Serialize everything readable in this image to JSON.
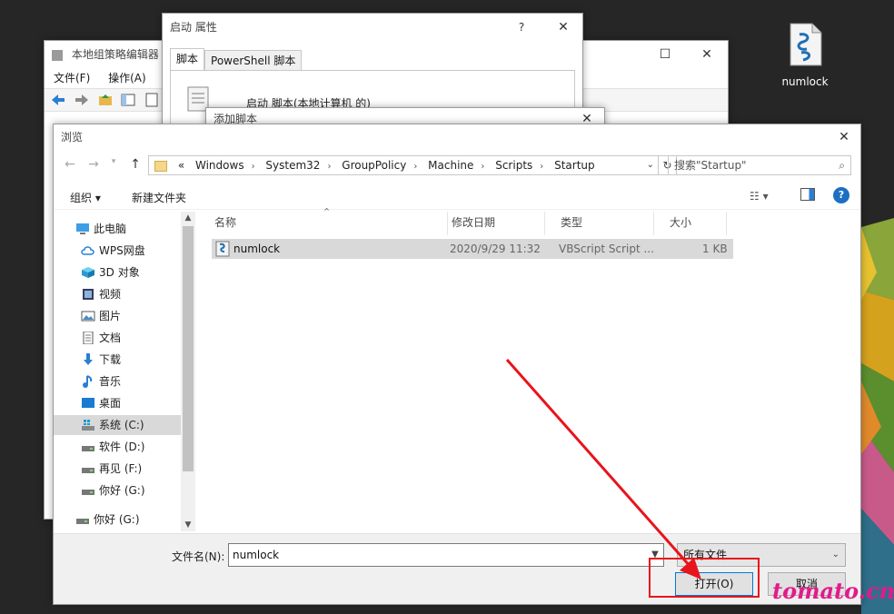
{
  "desktop": {
    "icon_label": "numlock",
    "watermark": "tomato.cn"
  },
  "gpe_window": {
    "title": "本地组策略编辑器",
    "menu": [
      "文件(F)",
      "操作(A)",
      "查"
    ]
  },
  "props_window": {
    "title": "启动 属性",
    "help": "?",
    "tabs": [
      "脚本",
      "PowerShell 脚本"
    ],
    "heading": "启动 脚本(本地计算机 的)"
  },
  "add_script_window": {
    "title": "添加脚本"
  },
  "browse_dialog": {
    "title": "浏览",
    "address_prefix": "«",
    "path": [
      "Windows",
      "System32",
      "GroupPolicy",
      "Machine",
      "Scripts",
      "Startup"
    ],
    "search_placeholder": "搜索\"Startup\"",
    "toolbar": {
      "organize": "组织 ▾",
      "new_folder": "新建文件夹"
    },
    "nav_items": [
      {
        "label": "此电脑",
        "icon": "computer-icon"
      },
      {
        "label": "WPS网盘",
        "icon": "cloud-icon"
      },
      {
        "label": "3D 对象",
        "icon": "cube-icon"
      },
      {
        "label": "视频",
        "icon": "video-icon"
      },
      {
        "label": "图片",
        "icon": "picture-icon"
      },
      {
        "label": "文档",
        "icon": "document-icon"
      },
      {
        "label": "下载",
        "icon": "download-icon"
      },
      {
        "label": "音乐",
        "icon": "music-icon"
      },
      {
        "label": "桌面",
        "icon": "desktop-icon"
      },
      {
        "label": "系统 (C:)",
        "icon": "system-drive-icon"
      },
      {
        "label": "软件 (D:)",
        "icon": "drive-icon"
      },
      {
        "label": "再见 (F:)",
        "icon": "drive-icon"
      },
      {
        "label": "你好 (G:)",
        "icon": "drive-icon"
      },
      {
        "label": "你好 (G:)",
        "icon": "drive-icon"
      }
    ],
    "columns": [
      "名称",
      "修改日期",
      "类型",
      "大小"
    ],
    "files": [
      {
        "name": "numlock",
        "modified": "2020/9/29 11:32",
        "type": "VBScript Script ...",
        "size": "1 KB"
      }
    ],
    "filename_label": "文件名(N):",
    "filename_value": "numlock",
    "file_type": "所有文件",
    "open_button": "打开(O)",
    "cancel_button": "取消"
  },
  "colors": {
    "annotation": "#e8141c",
    "watermark": "#e21b8a",
    "accent": "#0078d7"
  }
}
